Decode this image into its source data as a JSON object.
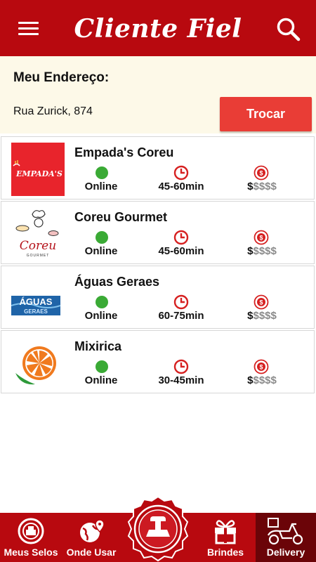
{
  "header": {
    "title": "Cliente Fiel",
    "menu_icon": "hamburger-menu-icon",
    "search_icon": "search-icon"
  },
  "address": {
    "title": "Meu Endereço:",
    "value": "Rua Zurick, 874",
    "change_label": "Trocar"
  },
  "stores": [
    {
      "name": "Empada's Coreu",
      "status": "Online",
      "time": "45-60min",
      "price_level": 1,
      "price_max": 5,
      "logo": "empadas-logo"
    },
    {
      "name": "Coreu Gourmet",
      "status": "Online",
      "time": "45-60min",
      "price_level": 1,
      "price_max": 5,
      "logo": "coreu-gourmet-logo"
    },
    {
      "name": "Águas Geraes",
      "status": "Online",
      "time": "60-75min",
      "price_level": 1,
      "price_max": 5,
      "logo": "aguas-geraes-logo"
    },
    {
      "name": "Mixirica",
      "status": "Online",
      "time": "30-45min",
      "price_level": 1,
      "price_max": 5,
      "logo": "mixirica-logo"
    }
  ],
  "logo_texts": {
    "empadas": "EMPADA'S",
    "coreu": "Coreu",
    "coreu_sub": "GOURMET",
    "aguas": "ÁGUAS",
    "aguas_sub": "GERAES"
  },
  "price_symbols": {
    "on": "$",
    "off": "$$$$"
  },
  "bottom_nav": [
    {
      "label": "Meus Selos",
      "icon": "stamp-badge-icon"
    },
    {
      "label": "Onde Usar",
      "icon": "globe-pin-icon"
    },
    {
      "label": "",
      "icon": "center-stamp-icon"
    },
    {
      "label": "Brindes",
      "icon": "gift-icon"
    },
    {
      "label": "Delivery",
      "icon": "scooter-icon",
      "active": true
    }
  ],
  "colors": {
    "primary": "#b8090f",
    "primary_dark": "#6b0408",
    "button": "#e93d36",
    "online": "#3aaa35",
    "address_bg": "#fdf9e8"
  }
}
